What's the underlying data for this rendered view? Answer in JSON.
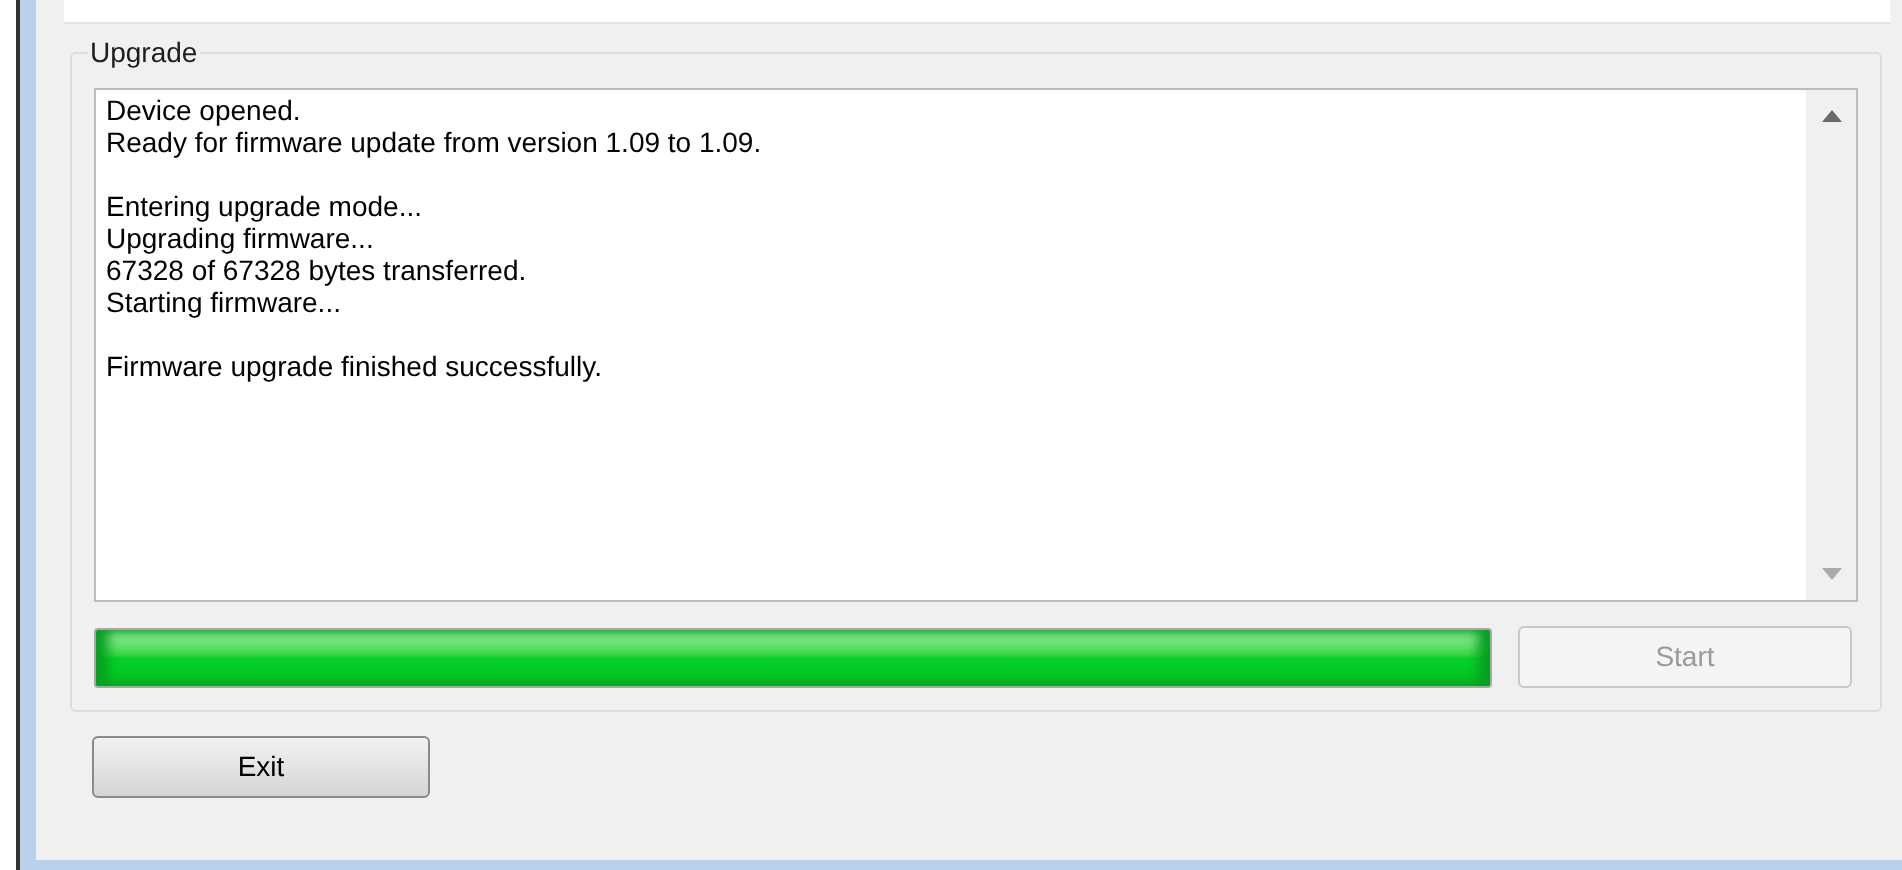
{
  "upgrade_group": {
    "title": "Upgrade",
    "log": [
      [
        "Device opened.",
        "Ready for firmware update from version 1.09 to 1.09."
      ],
      [
        "Entering upgrade mode...",
        "Upgrading firmware...",
        "67328 of 67328 bytes transferred.",
        "Starting firmware..."
      ],
      [
        "Firmware upgrade finished successfully."
      ]
    ],
    "progress": {
      "level": 1
    },
    "start_button": {
      "label": "Start",
      "disabled": true
    }
  },
  "exit_button": {
    "label": "Exit",
    "disabled": false
  }
}
